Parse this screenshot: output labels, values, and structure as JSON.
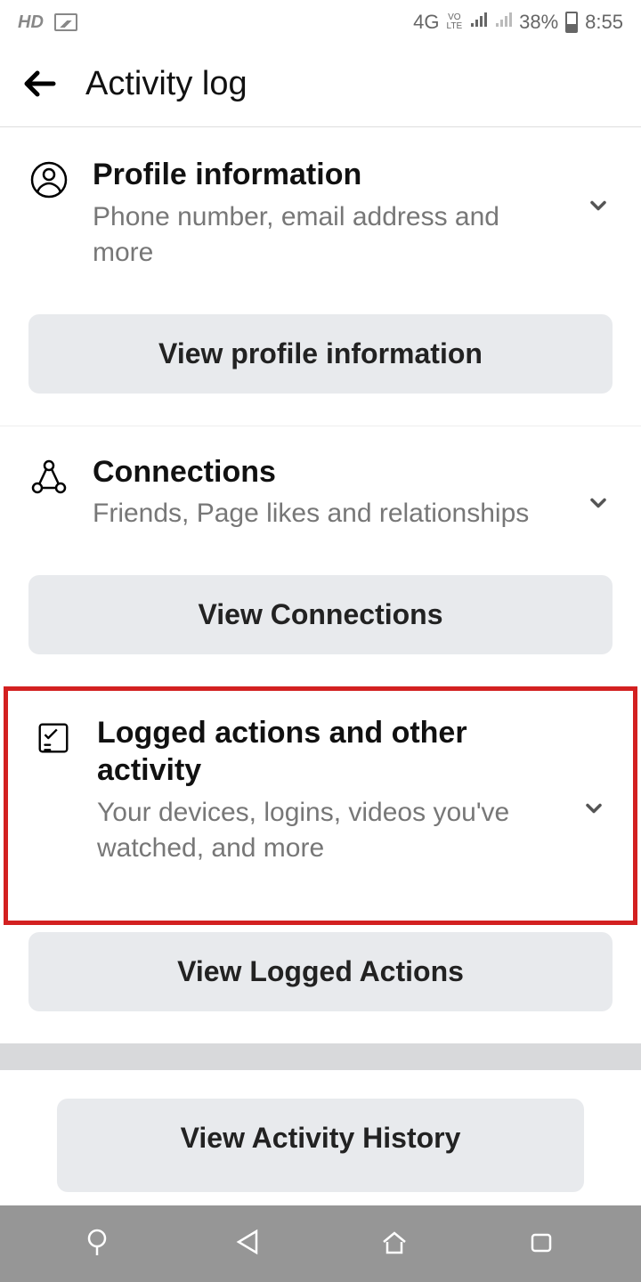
{
  "status": {
    "hd": "HD",
    "network": "4G",
    "volte_top": "VO",
    "volte_bottom": "LTE",
    "battery_pct": "38%",
    "time": "8:55"
  },
  "header": {
    "title": "Activity log"
  },
  "sections": {
    "profile": {
      "title": "Profile information",
      "subtitle": "Phone number, email address and more",
      "button": "View profile information"
    },
    "connections": {
      "title": "Connections",
      "subtitle": "Friends, Page likes and relationships",
      "button": "View Connections"
    },
    "logged": {
      "title": "Logged actions and other activity",
      "subtitle": "Your devices, logins, videos you've watched, and more",
      "button": "View Logged Actions"
    },
    "history": {
      "button": "View Activity History"
    }
  }
}
